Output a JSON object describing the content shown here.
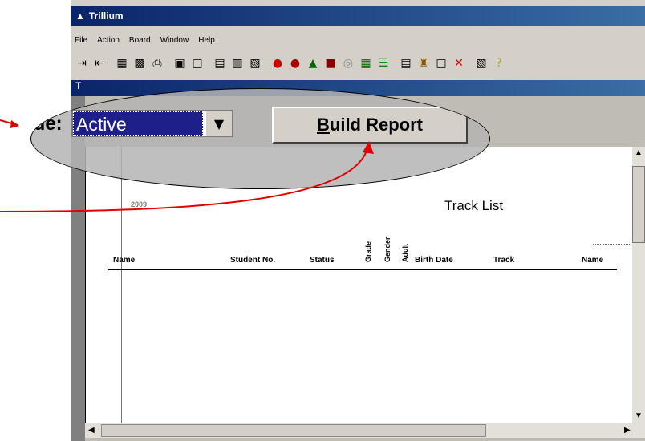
{
  "app": {
    "title": "Trillium",
    "menu": [
      "File",
      "Action",
      "Board",
      "Window",
      "Help"
    ],
    "doc_title": "T"
  },
  "callout": {
    "field_label": "ude:",
    "select_value": "Active",
    "build_button_label_first": "B",
    "build_button_label_rest": "uild Report"
  },
  "report": {
    "top_left_text": "2009",
    "title": "Track  List",
    "columns": [
      "Name",
      "Student No.",
      "Status",
      "Grade",
      "Gender",
      "Adult",
      "Birth Date",
      "Track",
      "Name"
    ]
  },
  "toolbar_icons": [
    "arrow-in-icon",
    "arrow-out-icon",
    "grid-icon",
    "chart-icon",
    "printer-icon",
    "save-icon",
    "window-icon",
    "report-icon",
    "report2-icon",
    "report3-icon",
    "apple-icon",
    "apples-icon",
    "tree-icon",
    "book-icon",
    "disc-icon",
    "board-icon",
    "bars-icon",
    "list-icon",
    "building-icon",
    "page-icon",
    "close-icon",
    "form-icon",
    "help-icon"
  ],
  "colors": {
    "titlebar": "#0a246a",
    "select_highlight": "#1f1f8b",
    "arrow": "#e00000"
  }
}
